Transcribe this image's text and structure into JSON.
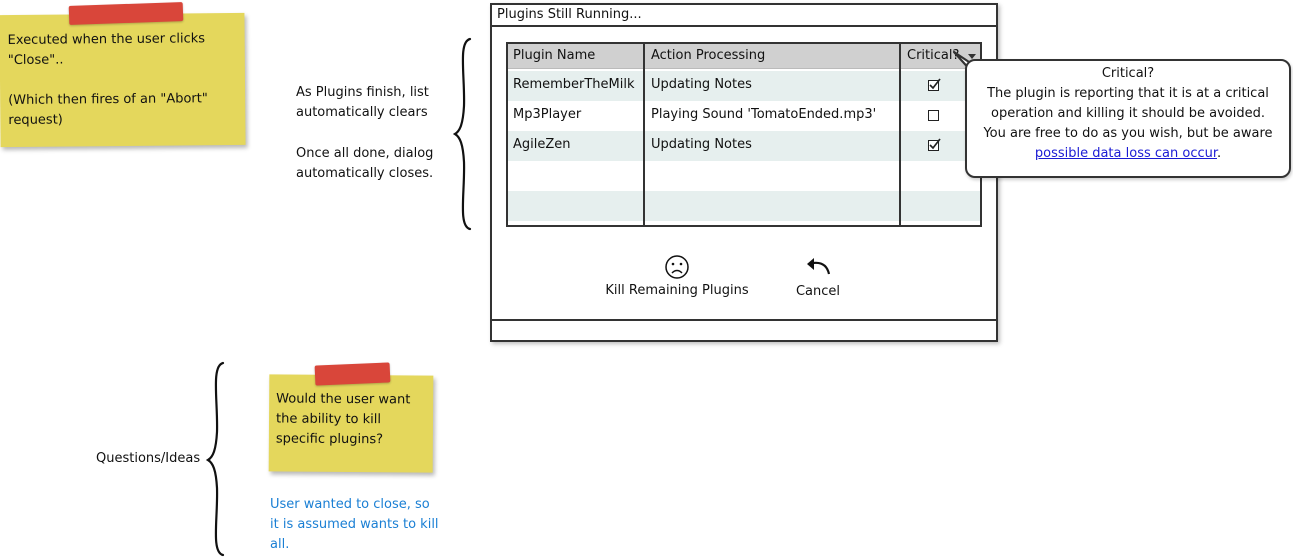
{
  "notes": {
    "close_note": {
      "line1": "Executed when the user clicks",
      "line2": "\"Close\"..",
      "line3": "(Which then fires of an \"Abort\"",
      "line4": "request)"
    },
    "question_note": {
      "line1": "Would the user want",
      "line2": "the ability to kill",
      "line3": "specific plugins?"
    },
    "colors": {
      "sticky": "#e4d75c",
      "tape": "#d9463a",
      "answer": "#1a7fd4"
    }
  },
  "annotations": {
    "list_clears_1": "As Plugins finish, list",
    "list_clears_2": "automatically clears",
    "dialog_closes_1": "Once all done, dialog",
    "dialog_closes_2": "automatically closes.",
    "questions_label": "Questions/Ideas",
    "answer_1": "User wanted to close, so",
    "answer_2": "it is assumed wants to kill",
    "answer_3": "all."
  },
  "dialog": {
    "title": "Plugins Still Running...",
    "columns": {
      "name": "Plugin Name",
      "action": "Action Processing",
      "critical": "Critical?"
    },
    "rows": [
      {
        "name": "RememberTheMilk",
        "action": "Updating Notes",
        "critical": true
      },
      {
        "name": "Mp3Player",
        "action": "Playing Sound 'TomatoEnded.mp3'",
        "critical": false
      },
      {
        "name": "AgileZen",
        "action": "Updating Notes",
        "critical": true
      }
    ],
    "kill_button": {
      "label": "Kill Remaining Plugins",
      "icon": "sad-face-icon"
    },
    "cancel_button": {
      "label": "Cancel",
      "icon": "undo-arrow-icon"
    }
  },
  "callout": {
    "title": "Critical?",
    "line1": "The plugin is reporting that it is at a critical",
    "line2": "operation and killing it should be avoided.",
    "line3": "You are free to do as you wish, but be aware",
    "link": "possible data loss can occur",
    "link_suffix": "."
  }
}
